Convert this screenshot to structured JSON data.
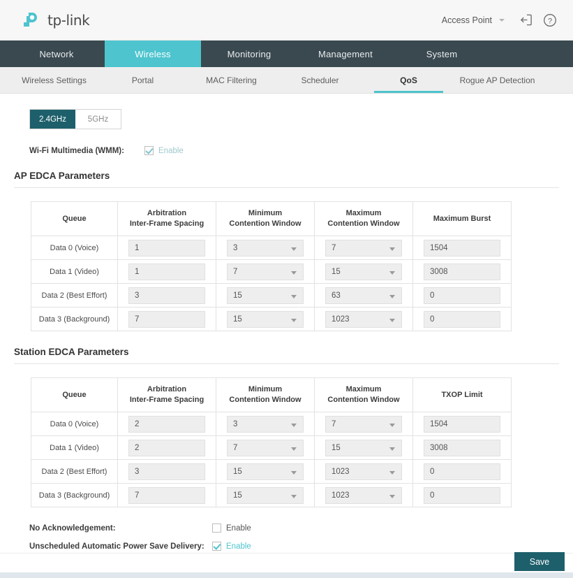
{
  "header": {
    "brand_name": "tp-link",
    "mode_value": "Access Point",
    "logout_icon": "logout-icon",
    "help_icon": "help-circle-icon"
  },
  "main_nav": {
    "items": [
      {
        "label": "Network",
        "active": false
      },
      {
        "label": "Wireless",
        "active": true
      },
      {
        "label": "Monitoring",
        "active": false
      },
      {
        "label": "Management",
        "active": false
      },
      {
        "label": "System",
        "active": false
      }
    ]
  },
  "sub_nav": {
    "items": [
      {
        "label": "Wireless Settings",
        "active": false
      },
      {
        "label": "Portal",
        "active": false
      },
      {
        "label": "MAC Filtering",
        "active": false
      },
      {
        "label": "Scheduler",
        "active": false
      },
      {
        "label": "QoS",
        "active": true
      },
      {
        "label": "Rogue AP Detection",
        "active": false
      }
    ]
  },
  "band_toggle": {
    "options": [
      {
        "label": "2.4GHz",
        "active": true
      },
      {
        "label": "5GHz",
        "active": false
      }
    ]
  },
  "wmm": {
    "label": "Wi-Fi Multimedia (WMM):",
    "checkbox_label": "Enable",
    "checked": true
  },
  "ap_edca": {
    "title": "AP EDCA Parameters",
    "columns": [
      "Queue",
      "Arbitration Inter-Frame Spacing",
      "Minimum Contention Window",
      "Maximum Contention Window",
      "Maximum Burst"
    ],
    "column_lines": [
      [
        "Queue"
      ],
      [
        "Arbitration",
        "Inter-Frame Spacing"
      ],
      [
        "Minimum",
        "Contention Window"
      ],
      [
        "Maximum",
        "Contention Window"
      ],
      [
        "Maximum Burst"
      ]
    ],
    "rows": [
      {
        "queue": "Data 0 (Voice)",
        "aifs": "1",
        "cwmin": "3",
        "cwmax": "7",
        "burst": "1504"
      },
      {
        "queue": "Data 1 (Video)",
        "aifs": "1",
        "cwmin": "7",
        "cwmax": "15",
        "burst": "3008"
      },
      {
        "queue": "Data 2 (Best Effort)",
        "aifs": "3",
        "cwmin": "15",
        "cwmax": "63",
        "burst": "0"
      },
      {
        "queue": "Data 3 (Background)",
        "aifs": "7",
        "cwmin": "15",
        "cwmax": "1023",
        "burst": "0"
      }
    ]
  },
  "station_edca": {
    "title": "Station EDCA Parameters",
    "columns": [
      "Queue",
      "Arbitration Inter-Frame Spacing",
      "Minimum Contention Window",
      "Maximum Contention Window",
      "TXOP Limit"
    ],
    "column_lines": [
      [
        "Queue"
      ],
      [
        "Arbitration",
        "Inter-Frame Spacing"
      ],
      [
        "Minimum",
        "Contention Window"
      ],
      [
        "Maximum",
        "Contention Window"
      ],
      [
        "TXOP Limit"
      ]
    ],
    "rows": [
      {
        "queue": "Data 0 (Voice)",
        "aifs": "2",
        "cwmin": "3",
        "cwmax": "7",
        "txop": "1504"
      },
      {
        "queue": "Data 1 (Video)",
        "aifs": "2",
        "cwmin": "7",
        "cwmax": "15",
        "txop": "3008"
      },
      {
        "queue": "Data 2 (Best Effort)",
        "aifs": "3",
        "cwmin": "15",
        "cwmax": "1023",
        "txop": "0"
      },
      {
        "queue": "Data 3 (Background)",
        "aifs": "7",
        "cwmin": "15",
        "cwmax": "1023",
        "txop": "0"
      }
    ]
  },
  "options": {
    "no_ack_label": "No Acknowledgement:",
    "no_ack_checkbox_label": "Enable",
    "no_ack_checked": false,
    "uapsd_label": "Unscheduled Automatic Power Save Delivery:",
    "uapsd_checkbox_label": "Enable",
    "uapsd_checked": true
  },
  "footer": {
    "save_label": "Save"
  },
  "colors": {
    "accent_cyan": "#4dc4ce",
    "nav_dark": "#3a4950",
    "button_teal": "#1d5f6b"
  }
}
